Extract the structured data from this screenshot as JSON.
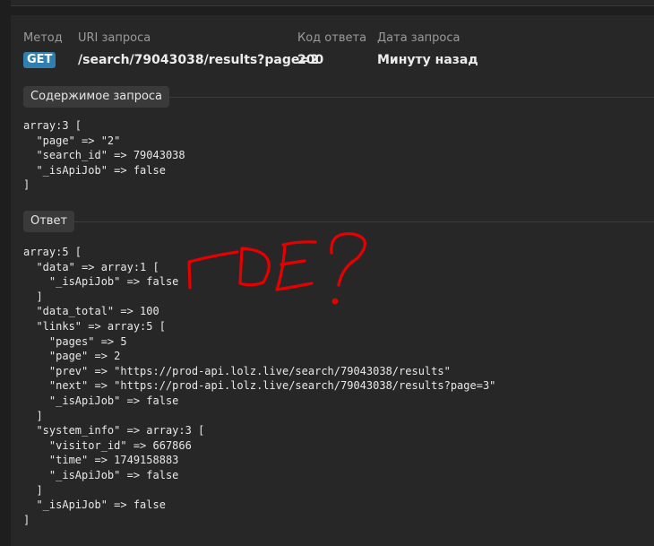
{
  "header": {
    "method_label": "Метод",
    "uri_label": "URI запроса",
    "code_label": "Код ответа",
    "date_label": "Дата запроса",
    "method": "GET",
    "uri": "/search/79043038/results?page=2",
    "code": "200",
    "date": "Минуту назад"
  },
  "request": {
    "section_label": "Содержимое запроса",
    "body": "array:3 [\n  \"page\" => \"2\"\n  \"search_id\" => 79043038\n  \"_isApiJob\" => false\n]"
  },
  "response": {
    "section_label": "Ответ",
    "body": "array:5 [\n  \"data\" => array:1 [\n    \"_isApiJob\" => false\n  ]\n  \"data_total\" => 100\n  \"links\" => array:5 [\n    \"pages\" => 5\n    \"page\" => 2\n    \"prev\" => \"https://prod-api.lolz.live/search/79043038/results\"\n    \"next\" => \"https://prod-api.lolz.live/search/79043038/results?page=3\"\n    \"_isApiJob\" => false\n  ]\n  \"system_info\" => array:3 [\n    \"visitor_id\" => 667866\n    \"time\" => 1749158883\n    \"_isApiJob\" => false\n  ]\n  \"_isApiJob\" => false\n]"
  },
  "annotation": {
    "text": "ГDE?",
    "color": "#e60000"
  },
  "colors": {
    "background": "#1e1e1e",
    "panel": "#272727",
    "badge": "#2f7fb0"
  }
}
